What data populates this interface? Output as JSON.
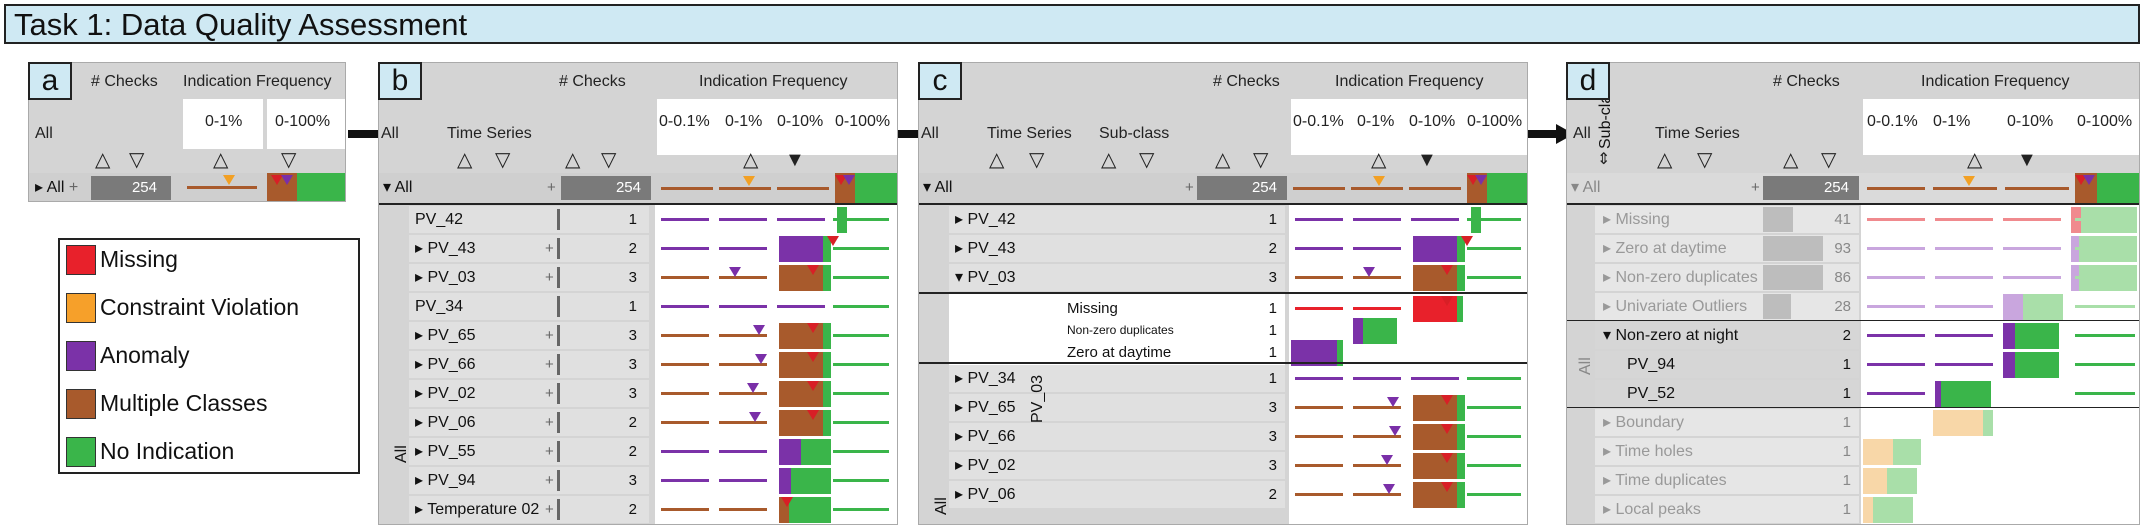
{
  "title": "Task 1: Data Quality Assessment",
  "panel_labels": [
    "a",
    "b",
    "c",
    "d"
  ],
  "headers": {
    "checks": "# Checks",
    "indication_frequency": "Indication Frequency",
    "time_series": "Time Series",
    "sub_class": "Sub-class",
    "all": "All",
    "a_bins": [
      "0-1%",
      "0-100%"
    ],
    "bins": [
      "0-0.1%",
      "0-1%",
      "0-10%",
      "0-100%"
    ]
  },
  "legend": [
    {
      "label": "Missing",
      "color": "#e8212b"
    },
    {
      "label": "Constraint Violation",
      "color": "#f6a02a"
    },
    {
      "label": "Anomaly",
      "color": "#7b32a8"
    },
    {
      "label": "Multiple Classes",
      "color": "#a85a2c"
    },
    {
      "label": "No Indication",
      "color": "#3ab54a"
    }
  ],
  "colors": {
    "missing": "#e8212b",
    "constraint": "#f6a02a",
    "anomaly": "#7b32a8",
    "multiple": "#a85a2c",
    "none": "#3ab54a",
    "header_bg": "#d4d4d4",
    "label_bg": "#cfe9f3"
  },
  "panel_a": {
    "row_label": "All",
    "count": "254"
  },
  "panel_b": {
    "all_label": "All",
    "all_count": "254",
    "group_label": "All",
    "rows": [
      {
        "name": "PV_42",
        "count": "1",
        "expand": false
      },
      {
        "name": "PV_43",
        "count": "2",
        "expand": true
      },
      {
        "name": "PV_03",
        "count": "3",
        "expand": true
      },
      {
        "name": "PV_34",
        "count": "1",
        "expand": false
      },
      {
        "name": "PV_65",
        "count": "3",
        "expand": true
      },
      {
        "name": "PV_66",
        "count": "3",
        "expand": true
      },
      {
        "name": "PV_02",
        "count": "3",
        "expand": true
      },
      {
        "name": "PV_06",
        "count": "2",
        "expand": true
      },
      {
        "name": "PV_55",
        "count": "2",
        "expand": true
      },
      {
        "name": "PV_94",
        "count": "3",
        "expand": true
      },
      {
        "name": "Temperature 02",
        "count": "2",
        "expand": true
      }
    ]
  },
  "panel_c": {
    "all_label": "All",
    "all_count": "254",
    "group_label": "All",
    "sub_group": "PV_03",
    "rows_top": [
      {
        "name": "PV_42",
        "count": "1"
      },
      {
        "name": "PV_43",
        "count": "2"
      },
      {
        "name": "PV_03",
        "count": "3"
      }
    ],
    "sub_rows": [
      {
        "name": "Missing",
        "count": "1"
      },
      {
        "name": "Non-zero duplicates",
        "count": "1"
      },
      {
        "name": "Zero at daytime",
        "count": "1"
      }
    ],
    "rows_bottom": [
      {
        "name": "PV_34",
        "count": "1"
      },
      {
        "name": "PV_65",
        "count": "3"
      },
      {
        "name": "PV_66",
        "count": "3"
      },
      {
        "name": "PV_02",
        "count": "3"
      },
      {
        "name": "PV_06",
        "count": "2"
      }
    ]
  },
  "panel_d": {
    "all_label": "All",
    "all_count": "254",
    "group_label": "All",
    "rows": [
      {
        "name": "Missing",
        "count": "41"
      },
      {
        "name": "Zero at daytime",
        "count": "93"
      },
      {
        "name": "Non-zero duplicates",
        "count": "86"
      },
      {
        "name": "Univariate Outliers",
        "count": "28"
      },
      {
        "name": "Non-zero at night",
        "count": "2"
      },
      {
        "name": "PV_94",
        "count": "1"
      },
      {
        "name": "PV_52",
        "count": "1"
      },
      {
        "name": "Boundary",
        "count": "1"
      },
      {
        "name": "Time holes",
        "count": "1"
      },
      {
        "name": "Time duplicates",
        "count": "1"
      },
      {
        "name": "Local peaks",
        "count": "1"
      }
    ]
  }
}
